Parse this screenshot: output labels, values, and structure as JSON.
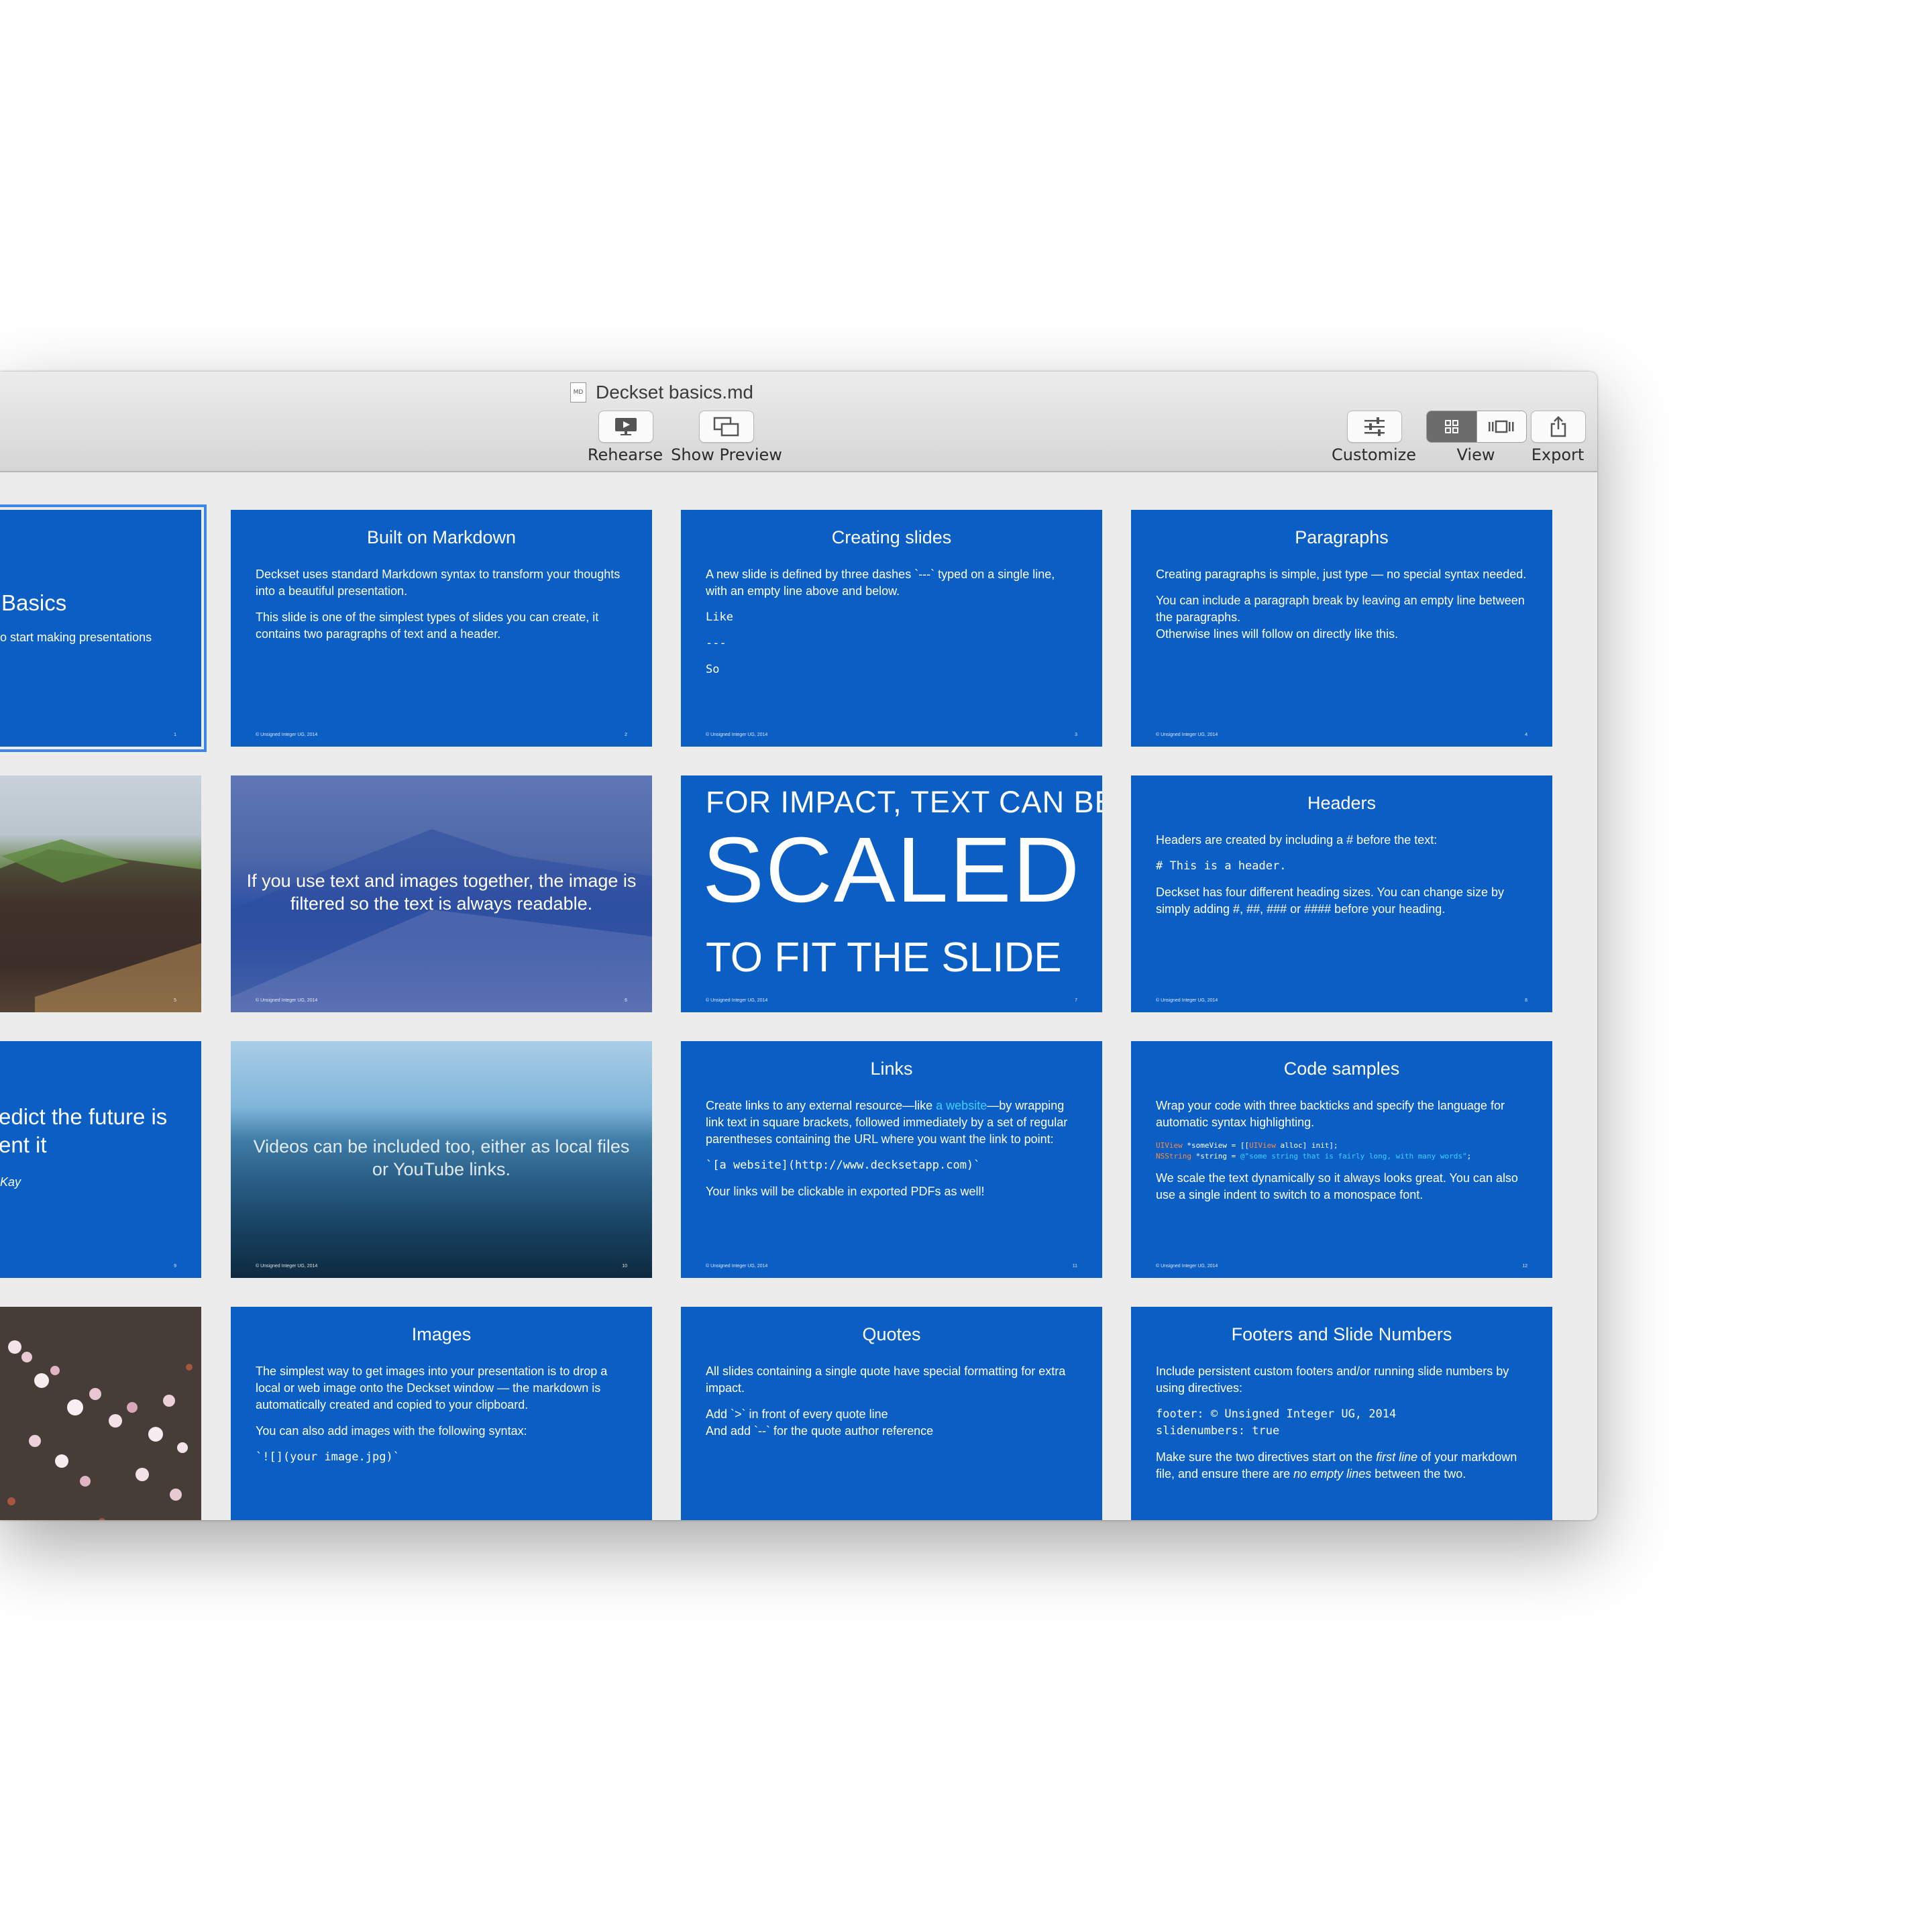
{
  "window": {
    "title": "Deckset basics.md",
    "doc_icon_label": "MD"
  },
  "toolbar": {
    "rehearse": "Rehearse",
    "show_preview": "Show Preview",
    "customize": "Customize",
    "view": "View",
    "export": "Export"
  },
  "slides": {
    "s1": {
      "title": "Basics",
      "subtitle": "o start making presentations",
      "num": "1"
    },
    "s2": {
      "title": "Built on Markdown",
      "p1": "Deckset uses standard Markdown syntax to transform your thoughts into a beautiful presentation.",
      "p2": "This slide is one of the simplest types of slides you can create, it contains two paragraphs of text and a header.",
      "footer": "© Unsigned Integer UG, 2014",
      "num": "2"
    },
    "s3": {
      "title": "Creating slides",
      "p1": "A new slide is defined by three dashes `---` typed on a single line, with an empty line above and below.",
      "c1": "Like",
      "c2": "---",
      "c3": "So",
      "footer": "© Unsigned Integer UG, 2014",
      "num": "3"
    },
    "s4": {
      "title": "Paragraphs",
      "p1": "Creating paragraphs is simple, just type — no special syntax needed.",
      "p2": "You can include a paragraph break by leaving an empty line between the paragraphs.",
      "p3": "Otherwise lines will follow on directly like this.",
      "footer": "© Unsigned Integer UG, 2014",
      "num": "4"
    },
    "s5": {
      "num": "5"
    },
    "s6": {
      "text": "If you use text and images together, the image is filtered so the text is always readable.",
      "footer": "© Unsigned Integer UG, 2014",
      "num": "6"
    },
    "s7": {
      "line1": "FOR IMPACT, TEXT CAN BE",
      "line2": "SCALED",
      "line3": "TO FIT THE SLIDE",
      "footer": "© Unsigned Integer UG, 2014",
      "num": "7"
    },
    "s8": {
      "title": "Headers",
      "p1": "Headers are created by including a # before the text:",
      "code": "# This is a header.",
      "p2": "Deckset has four different heading sizes. You can change size by simply adding #, ##, ### or #### before your heading.",
      "footer": "© Unsigned Integer UG, 2014",
      "num": "8"
    },
    "s9": {
      "quote1": "edict the future is",
      "quote2": "ent it",
      "author": "Kay",
      "num": "9"
    },
    "s10": {
      "text": "Videos can be included too, either as local files or YouTube links.",
      "footer": "© Unsigned Integer UG, 2014",
      "num": "10"
    },
    "s11": {
      "title": "Links",
      "p1a": "Create links to any external resource—like ",
      "p1link": "a website",
      "p1b": "—by wrapping link text in square brackets, followed immediately by a set of regular parentheses containing the URL where you want the link to point:",
      "code": "`[a website](http://www.decksetapp.com)`",
      "p2": "Your links will be clickable in exported PDFs as well!",
      "footer": "© Unsigned Integer UG, 2014",
      "num": "11"
    },
    "s12": {
      "title": "Code samples",
      "p1": "Wrap your code with three backticks and specify the language for automatic syntax highlighting.",
      "code1a": "UIView",
      "code1b": " *someView = [[",
      "code1c": "UIView",
      "code1d": " alloc] init];",
      "code2a": "NSString",
      "code2b": " *string = ",
      "code2c": "@\"some string that is fairly long, with many words\"",
      "code2d": ";",
      "p2": "We scale the text dynamically so it always looks great. You can also use a single indent to switch to a monospace font.",
      "footer": "© Unsigned Integer UG, 2014",
      "num": "12"
    },
    "s13": {},
    "s14": {
      "title": "Images",
      "p1": "The simplest way to get images into your presentation is to drop a local or web image onto the Deckset window — the markdown is automatically created and copied to your clipboard.",
      "p2": "You can also add images with the following syntax:",
      "code": "`![](your image.jpg)`"
    },
    "s15": {
      "title": "Quotes",
      "p1": "All slides containing a single quote have special formatting for extra impact.",
      "p2": "Add `>` in front of every quote line",
      "p3": "And add `--` for the quote author reference"
    },
    "s16": {
      "title": "Footers and Slide Numbers",
      "p1": "Include persistent custom footers and/or running slide numbers by using directives:",
      "code1": "footer: © Unsigned Integer UG, 2014",
      "code2": "slidenumbers: true",
      "p2a": "Make sure the two directives start on the ",
      "p2i": "first line",
      "p2b": " of your markdown file, and ensure there are ",
      "p2i2": "no empty lines",
      "p2c": " between the two."
    }
  },
  "colors": {
    "slide_blue": "#0b5fc4",
    "selection": "#3d87e8",
    "link_cyan": "#3fd0ff",
    "code_orange": "#ff8a3d"
  }
}
